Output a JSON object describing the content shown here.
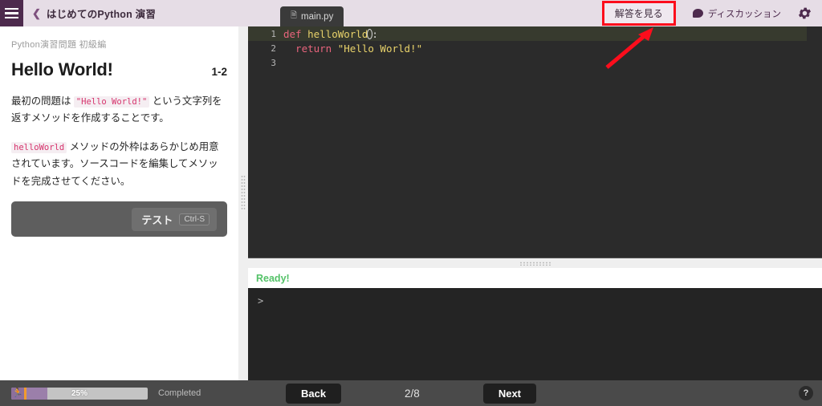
{
  "left": {
    "header": {
      "menu_icon": "hamburger-icon",
      "back_icon": "chevron-left-icon",
      "title": "はじめてのPython 演習"
    },
    "category": "Python演習問題 初級編",
    "problem_title": "Hello World!",
    "problem_number": "1-2",
    "paragraph1_a": "最初の問題は ",
    "paragraph1_code": "\"Hello World!\"",
    "paragraph1_b": " という文字列を返すメソッドを作成することです。",
    "paragraph2_code": "helloWorld",
    "paragraph2_b": " メソッドの外枠はあらかじめ用意されています。ソースコードを編集してメソッドを完成させてください。",
    "test_label": "テスト",
    "test_shortcut": "Ctrl-S"
  },
  "right": {
    "tab": {
      "icon": "file-icon",
      "label": "main.py"
    },
    "answer_button": "解答を見る",
    "discussion": {
      "icon": "speech-bubble-icon",
      "label": "ディスカッション"
    },
    "settings_icon": "gear-icon",
    "code": {
      "lines": [
        {
          "num": "1",
          "kw": "def",
          "fn": " helloWorld",
          "punc": ":"
        },
        {
          "num": "2",
          "kw": "  return",
          "str": " \"Hello World!\""
        },
        {
          "num": "3"
        }
      ]
    },
    "status_text": "Ready!",
    "console_prompt": ">"
  },
  "bottom": {
    "runner_icon": "runner-icon",
    "progress_percent": "25%",
    "completed_label": "Completed",
    "back_label": "Back",
    "page_indicator": "2/8",
    "next_label": "Next",
    "help_icon": "question-mark-icon"
  },
  "annotation": {
    "highlight_color": "#fc0d1c",
    "arrow_name": "red-pointer-arrow"
  }
}
